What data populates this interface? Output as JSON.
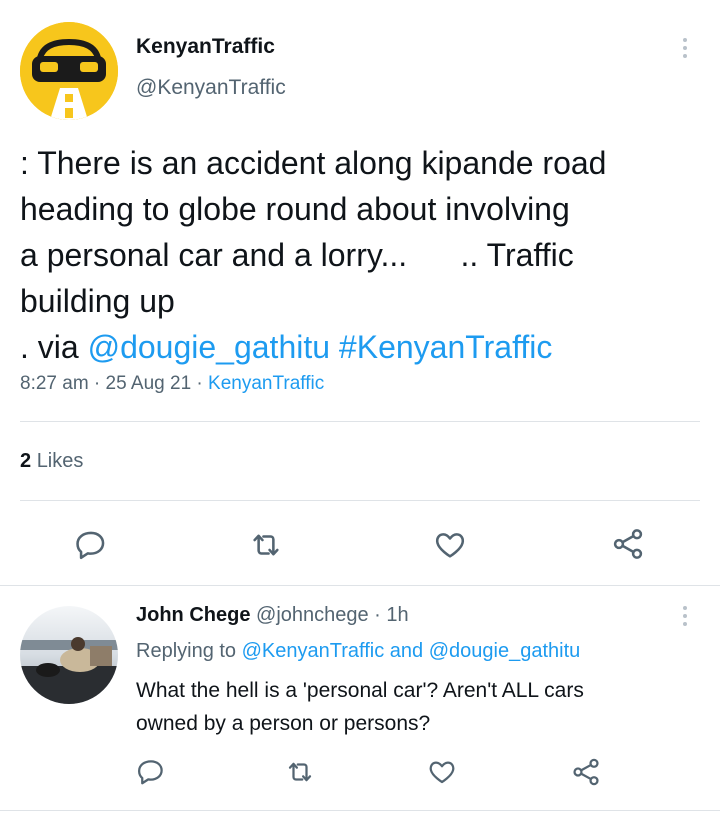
{
  "tweet": {
    "display_name": "KenyanTraffic",
    "handle": "@KenyanTraffic",
    "text_lines": [
      ": There is an accident along kipande road",
      "heading to globe round about involving",
      "a personal car and a lorry...      .. Traffic",
      "building up"
    ],
    "via_prefix": ". via ",
    "mention": "@dougie_gathitu",
    "hashtag": "#KenyanTraffic",
    "time": "8:27 am",
    "date": "25 Aug 21",
    "source": "KenyanTraffic",
    "likes_count": "2",
    "likes_label": "Likes"
  },
  "reply": {
    "display_name": "John Chege",
    "handle": "@johnchege",
    "time": "1h",
    "replying_to_label": "Replying to",
    "replying_to_1": "@KenyanTraffic",
    "replying_and": "and",
    "replying_to_2": "@dougie_gathitu",
    "text_lines": [
      "What the hell is a 'personal car'? Aren't ALL cars",
      "owned by a person or persons?"
    ]
  },
  "icons": {
    "comment": "comment-icon",
    "retweet": "retweet-icon",
    "like": "heart-icon",
    "share": "share-icon",
    "more": "more-vertical-icon"
  },
  "colors": {
    "link": "#1d9bf0",
    "secondary_text": "#536471",
    "avatar_yellow": "#f7c61c"
  }
}
